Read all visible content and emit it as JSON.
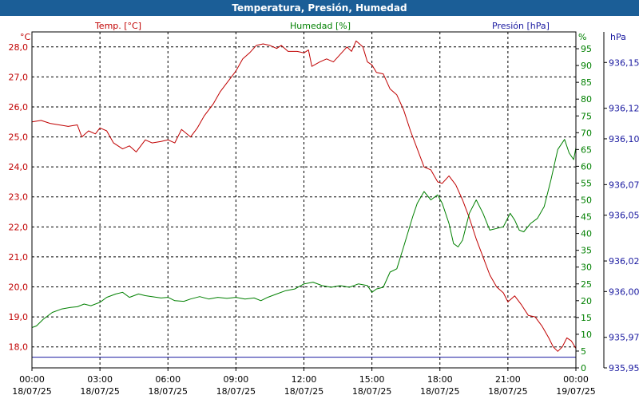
{
  "window_title": "Temperatura, Presión, Humedad",
  "colors": {
    "title_bg": "#1b5e97",
    "temperature": "#c00000",
    "humidity": "#008000",
    "pressure": "#1a1aa0",
    "grid": "#000000",
    "axis_temp_text": "#c00000",
    "axis_hum_text": "#008000",
    "axis_press_text": "#1a1aa0"
  },
  "chart_data": {
    "type": "line",
    "title": "Temperatura, Presión, Humedad",
    "grid": true,
    "axis_labels": {
      "temp_unit": "°C",
      "hum_unit": "%",
      "press_unit": "hPa"
    },
    "x_axis": {
      "range_hours": [
        0,
        24
      ],
      "ticks": [
        {
          "time": "00:00",
          "date": "18/07/25"
        },
        {
          "time": "03:00",
          "date": "18/07/25"
        },
        {
          "time": "06:00",
          "date": "18/07/25"
        },
        {
          "time": "09:00",
          "date": "18/07/25"
        },
        {
          "time": "12:00",
          "date": "18/07/25"
        },
        {
          "time": "15:00",
          "date": "18/07/25"
        },
        {
          "time": "18:00",
          "date": "18/07/25"
        },
        {
          "time": "21:00",
          "date": "18/07/25"
        },
        {
          "time": "00:00",
          "date": "19/07/25"
        }
      ]
    },
    "y_temp": {
      "range": [
        17.3,
        28.5
      ],
      "ticks": [
        "28,0",
        "27,0",
        "26,0",
        "25,0",
        "24,0",
        "23,0",
        "22,0",
        "21,0",
        "20,0",
        "19,0",
        "18,0"
      ]
    },
    "y_hum": {
      "range": [
        0,
        100
      ],
      "ticks": [
        "95",
        "90",
        "85",
        "80",
        "75",
        "70",
        "65",
        "60",
        "55",
        "50",
        "45",
        "40",
        "35",
        "30",
        "25",
        "20",
        "15",
        "10",
        "5",
        "0"
      ]
    },
    "y_press": {
      "range": [
        935.95,
        936.17
      ],
      "ticks": [
        "936,15",
        "936,12",
        "936,10",
        "936,07",
        "936,05",
        "936,02",
        "936,00",
        "935,97",
        "935,95"
      ]
    },
    "series": [
      {
        "name": "Temp. [°C]",
        "axis": "temp",
        "points": [
          [
            0.0,
            25.5
          ],
          [
            0.4,
            25.55
          ],
          [
            0.8,
            25.45
          ],
          [
            1.2,
            25.4
          ],
          [
            1.6,
            25.35
          ],
          [
            2.0,
            25.4
          ],
          [
            2.2,
            25.0
          ],
          [
            2.5,
            25.2
          ],
          [
            2.8,
            25.1
          ],
          [
            3.0,
            25.3
          ],
          [
            3.3,
            25.2
          ],
          [
            3.6,
            24.8
          ],
          [
            4.0,
            24.6
          ],
          [
            4.3,
            24.7
          ],
          [
            4.6,
            24.5
          ],
          [
            5.0,
            24.9
          ],
          [
            5.3,
            24.8
          ],
          [
            5.7,
            24.85
          ],
          [
            6.0,
            24.9
          ],
          [
            6.3,
            24.8
          ],
          [
            6.6,
            25.25
          ],
          [
            7.0,
            25.0
          ],
          [
            7.3,
            25.3
          ],
          [
            7.6,
            25.7
          ],
          [
            8.0,
            26.1
          ],
          [
            8.3,
            26.5
          ],
          [
            8.6,
            26.8
          ],
          [
            9.0,
            27.2
          ],
          [
            9.3,
            27.6
          ],
          [
            9.6,
            27.8
          ],
          [
            9.9,
            28.05
          ],
          [
            10.2,
            28.1
          ],
          [
            10.5,
            28.05
          ],
          [
            10.8,
            27.95
          ],
          [
            11.0,
            28.05
          ],
          [
            11.3,
            27.85
          ],
          [
            11.7,
            27.85
          ],
          [
            12.0,
            27.8
          ],
          [
            12.2,
            27.9
          ],
          [
            12.35,
            27.35
          ],
          [
            12.7,
            27.5
          ],
          [
            13.0,
            27.6
          ],
          [
            13.3,
            27.5
          ],
          [
            13.6,
            27.75
          ],
          [
            13.9,
            28.0
          ],
          [
            14.1,
            27.85
          ],
          [
            14.3,
            28.2
          ],
          [
            14.6,
            28.0
          ],
          [
            14.8,
            27.5
          ],
          [
            15.0,
            27.4
          ],
          [
            15.2,
            27.15
          ],
          [
            15.5,
            27.1
          ],
          [
            15.8,
            26.6
          ],
          [
            16.1,
            26.4
          ],
          [
            16.4,
            25.9
          ],
          [
            16.7,
            25.2
          ],
          [
            17.0,
            24.6
          ],
          [
            17.3,
            24.0
          ],
          [
            17.6,
            23.9
          ],
          [
            17.9,
            23.5
          ],
          [
            18.1,
            23.45
          ],
          [
            18.4,
            23.7
          ],
          [
            18.7,
            23.4
          ],
          [
            19.0,
            22.9
          ],
          [
            19.3,
            22.3
          ],
          [
            19.6,
            21.6
          ],
          [
            19.9,
            21.0
          ],
          [
            20.2,
            20.4
          ],
          [
            20.5,
            20.0
          ],
          [
            20.8,
            19.8
          ],
          [
            21.0,
            19.5
          ],
          [
            21.3,
            19.7
          ],
          [
            21.6,
            19.4
          ],
          [
            21.9,
            19.05
          ],
          [
            22.2,
            19.0
          ],
          [
            22.5,
            18.7
          ],
          [
            22.8,
            18.3
          ],
          [
            23.0,
            18.0
          ],
          [
            23.2,
            17.85
          ],
          [
            23.4,
            18.0
          ],
          [
            23.6,
            18.3
          ],
          [
            23.8,
            18.2
          ],
          [
            24.0,
            17.95
          ]
        ]
      },
      {
        "name": "Humedad [%]",
        "axis": "hum",
        "points": [
          [
            0.0,
            12.0
          ],
          [
            0.2,
            12.5
          ],
          [
            0.5,
            14.5
          ],
          [
            0.9,
            16.5
          ],
          [
            1.3,
            17.5
          ],
          [
            1.7,
            18.0
          ],
          [
            2.0,
            18.2
          ],
          [
            2.3,
            19.0
          ],
          [
            2.6,
            18.5
          ],
          [
            3.0,
            19.5
          ],
          [
            3.3,
            21.0
          ],
          [
            3.7,
            22.0
          ],
          [
            4.0,
            22.5
          ],
          [
            4.3,
            21.0
          ],
          [
            4.7,
            22.0
          ],
          [
            5.0,
            21.5
          ],
          [
            5.3,
            21.2
          ],
          [
            5.7,
            20.8
          ],
          [
            6.0,
            21.0
          ],
          [
            6.3,
            20.0
          ],
          [
            6.7,
            19.8
          ],
          [
            7.0,
            20.5
          ],
          [
            7.4,
            21.2
          ],
          [
            7.8,
            20.5
          ],
          [
            8.2,
            21.0
          ],
          [
            8.6,
            20.7
          ],
          [
            9.0,
            21.0
          ],
          [
            9.4,
            20.5
          ],
          [
            9.8,
            20.8
          ],
          [
            10.1,
            20.0
          ],
          [
            10.4,
            21.0
          ],
          [
            10.8,
            22.0
          ],
          [
            11.2,
            23.0
          ],
          [
            11.6,
            23.5
          ],
          [
            12.0,
            25.0
          ],
          [
            12.4,
            25.5
          ],
          [
            12.8,
            24.5
          ],
          [
            13.2,
            24.0
          ],
          [
            13.6,
            24.5
          ],
          [
            14.0,
            24.0
          ],
          [
            14.4,
            25.0
          ],
          [
            14.8,
            24.5
          ],
          [
            15.0,
            22.5
          ],
          [
            15.2,
            23.5
          ],
          [
            15.5,
            24.0
          ],
          [
            15.8,
            28.5
          ],
          [
            16.1,
            29.5
          ],
          [
            16.4,
            36.0
          ],
          [
            16.8,
            45.0
          ],
          [
            17.0,
            49.0
          ],
          [
            17.3,
            52.5
          ],
          [
            17.6,
            50.0
          ],
          [
            17.9,
            51.5
          ],
          [
            18.1,
            49.0
          ],
          [
            18.4,
            43.0
          ],
          [
            18.6,
            37.0
          ],
          [
            18.8,
            36.0
          ],
          [
            19.0,
            38.0
          ],
          [
            19.3,
            46.0
          ],
          [
            19.6,
            50.0
          ],
          [
            19.9,
            46.0
          ],
          [
            20.2,
            41.0
          ],
          [
            20.5,
            41.5
          ],
          [
            20.8,
            42.0
          ],
          [
            21.1,
            46.0
          ],
          [
            21.3,
            44.0
          ],
          [
            21.5,
            41.0
          ],
          [
            21.7,
            40.5
          ],
          [
            22.0,
            43.0
          ],
          [
            22.3,
            44.5
          ],
          [
            22.6,
            48.0
          ],
          [
            22.9,
            56.0
          ],
          [
            23.2,
            65.0
          ],
          [
            23.5,
            68.0
          ],
          [
            23.7,
            64.0
          ],
          [
            23.9,
            62.0
          ],
          [
            24.0,
            65.5
          ]
        ]
      },
      {
        "name": "Presión [hPa]",
        "axis": "press",
        "points": [
          [
            0.0,
            935.957
          ],
          [
            24.0,
            935.957
          ]
        ]
      }
    ]
  }
}
